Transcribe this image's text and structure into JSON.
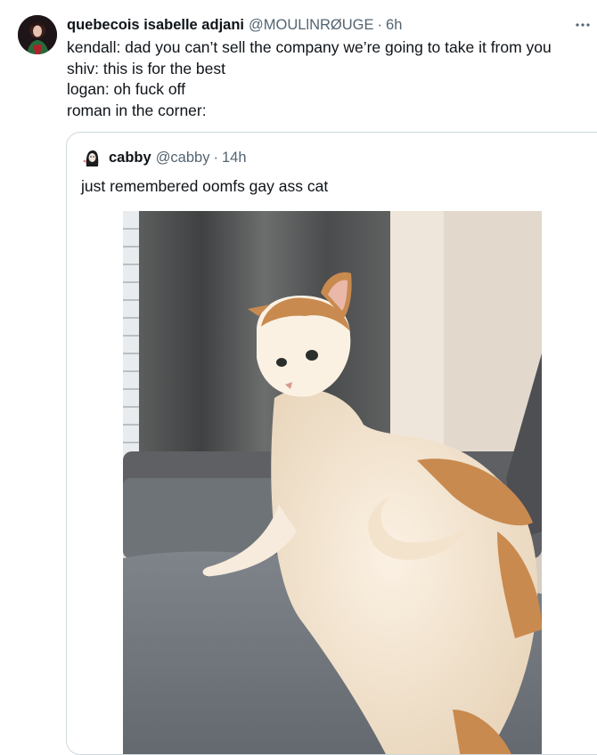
{
  "tweet": {
    "display_name": "quebecois isabelle adjani",
    "handle": "@MOULlNRØUGE",
    "separator": "·",
    "time": "6h",
    "more_icon": "ellipsis-icon",
    "lines": [
      "kendall: dad you can’t sell the company we’re going to take it from you",
      "shiv: this is for the best",
      "logan: oh fuck off",
      "roman in the corner:"
    ]
  },
  "quoted": {
    "display_name": "cabby",
    "handle": "@cabby",
    "separator": "·",
    "time": "14h",
    "text": "just remembered oomfs gay ass cat"
  },
  "colors": {
    "text_primary": "#0f1419",
    "text_secondary": "#536471",
    "border": "#cfd9de"
  }
}
